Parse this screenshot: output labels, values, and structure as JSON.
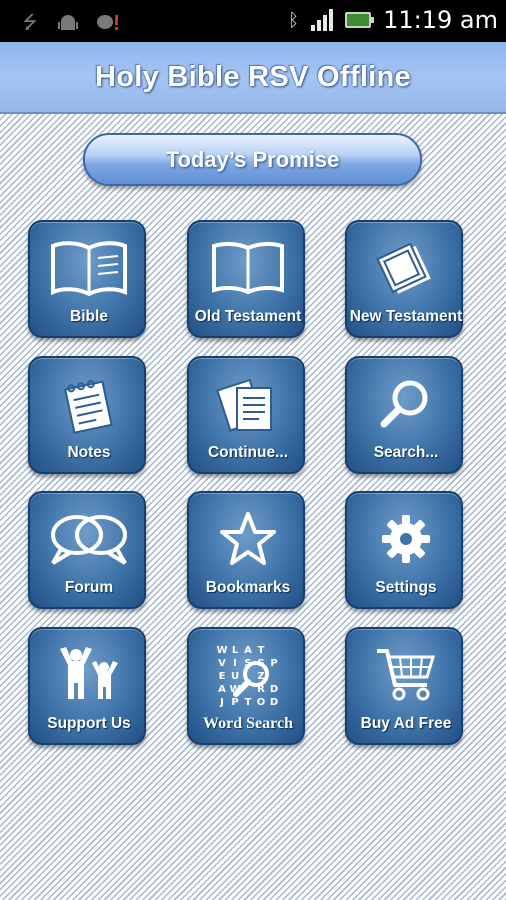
{
  "status_bar": {
    "time": "11:19 am",
    "icons": [
      "usb-icon",
      "android-icon",
      "alert-icon",
      "bluetooth-icon",
      "signal-icon",
      "battery-icon"
    ]
  },
  "header": {
    "title": "Holy Bible RSV Offline"
  },
  "promise_button": {
    "label": "Today’s Promise"
  },
  "tiles": [
    {
      "label": "Bible",
      "icon": "open-book-icon"
    },
    {
      "label": "Old Testament",
      "icon": "open-book-icon"
    },
    {
      "label": "New Testament",
      "icon": "stacked-pages-icon"
    },
    {
      "label": "Notes",
      "icon": "notepad-icon"
    },
    {
      "label": "Continue...",
      "icon": "documents-icon"
    },
    {
      "label": "Search...",
      "icon": "magnifier-icon"
    },
    {
      "label": "Forum",
      "icon": "speech-bubbles-icon"
    },
    {
      "label": "Bookmarks",
      "icon": "star-icon"
    },
    {
      "label": "Settings",
      "icon": "gear-icon"
    },
    {
      "label": "Support Us",
      "icon": "people-icon"
    },
    {
      "label": "Word Search",
      "icon": "word-search-icon"
    },
    {
      "label": "Buy Ad Free",
      "icon": "shopping-cart-icon"
    }
  ],
  "word_search_letters": [
    "W",
    "L",
    "A",
    "T",
    "",
    "V",
    "I",
    "S",
    "S",
    "P",
    "E",
    "U",
    "",
    "Z",
    "",
    "A",
    "W",
    "",
    "R",
    "D",
    "J",
    "P",
    "T",
    "O",
    "D"
  ],
  "colors": {
    "title_bar": "#a7c4f2",
    "tile": "#3f73a8",
    "tile_border": "#173f6e"
  }
}
